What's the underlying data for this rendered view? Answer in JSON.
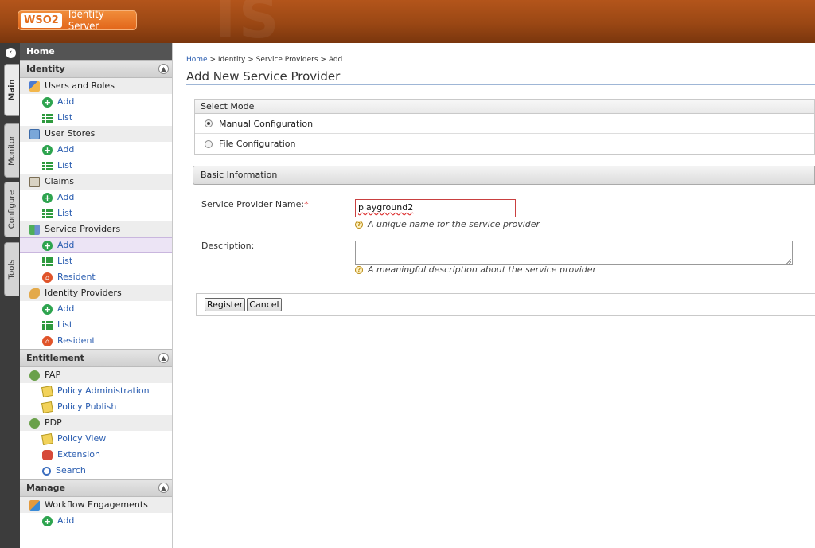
{
  "header": {
    "logo_brand": "WSO2",
    "product_name": "Identity Server",
    "watermark": "IS"
  },
  "vertical_tabs": [
    "Main",
    "Monitor",
    "Configure",
    "Tools"
  ],
  "sidebar": {
    "home": "Home",
    "sections": [
      {
        "title": "Identity",
        "categories": [
          {
            "label": "Users and Roles",
            "icon": "users-roles-icon",
            "items": [
              "Add",
              "List"
            ]
          },
          {
            "label": "User Stores",
            "icon": "user-stores-icon",
            "items": [
              "Add",
              "List"
            ]
          },
          {
            "label": "Claims",
            "icon": "claims-icon",
            "items": [
              "Add",
              "List"
            ]
          },
          {
            "label": "Service Providers",
            "icon": "service-providers-icon",
            "items": [
              "Add",
              "List",
              "Resident"
            ]
          },
          {
            "label": "Identity Providers",
            "icon": "identity-providers-icon",
            "items": [
              "Add",
              "List",
              "Resident"
            ]
          }
        ]
      },
      {
        "title": "Entitlement",
        "categories": [
          {
            "label": "PAP",
            "icon": "pap-icon",
            "items": [
              "Policy Administration",
              "Policy Publish"
            ]
          },
          {
            "label": "PDP",
            "icon": "pdp-icon",
            "items": [
              "Policy View",
              "Extension",
              "Search"
            ]
          }
        ]
      },
      {
        "title": "Manage",
        "categories": [
          {
            "label": "Workflow Engagements",
            "icon": "workflow-icon",
            "items": [
              "Add"
            ]
          }
        ]
      }
    ]
  },
  "breadcrumb": [
    "Home",
    "Identity",
    "Service Providers",
    "Add"
  ],
  "breadcrumb_sep": ">",
  "page_title": "Add New Service Provider",
  "select_mode": {
    "title": "Select Mode",
    "options": [
      "Manual Configuration",
      "File Configuration"
    ],
    "selected": "Manual Configuration"
  },
  "basic_info": {
    "title": "Basic Information",
    "name_label": "Service Provider Name:",
    "required_mark": "*",
    "name_value": "playground2",
    "name_hint": "A unique name for the service provider",
    "description_label": "Description:",
    "description_value": "",
    "description_hint": "A meaningful description about the service provider"
  },
  "buttons": {
    "register": "Register",
    "cancel": "Cancel"
  },
  "colors": {
    "header_orange": "#9a4714",
    "link_blue": "#2a5db0",
    "error_border": "#c94040",
    "selected_item_bg": "#ece4f5"
  }
}
